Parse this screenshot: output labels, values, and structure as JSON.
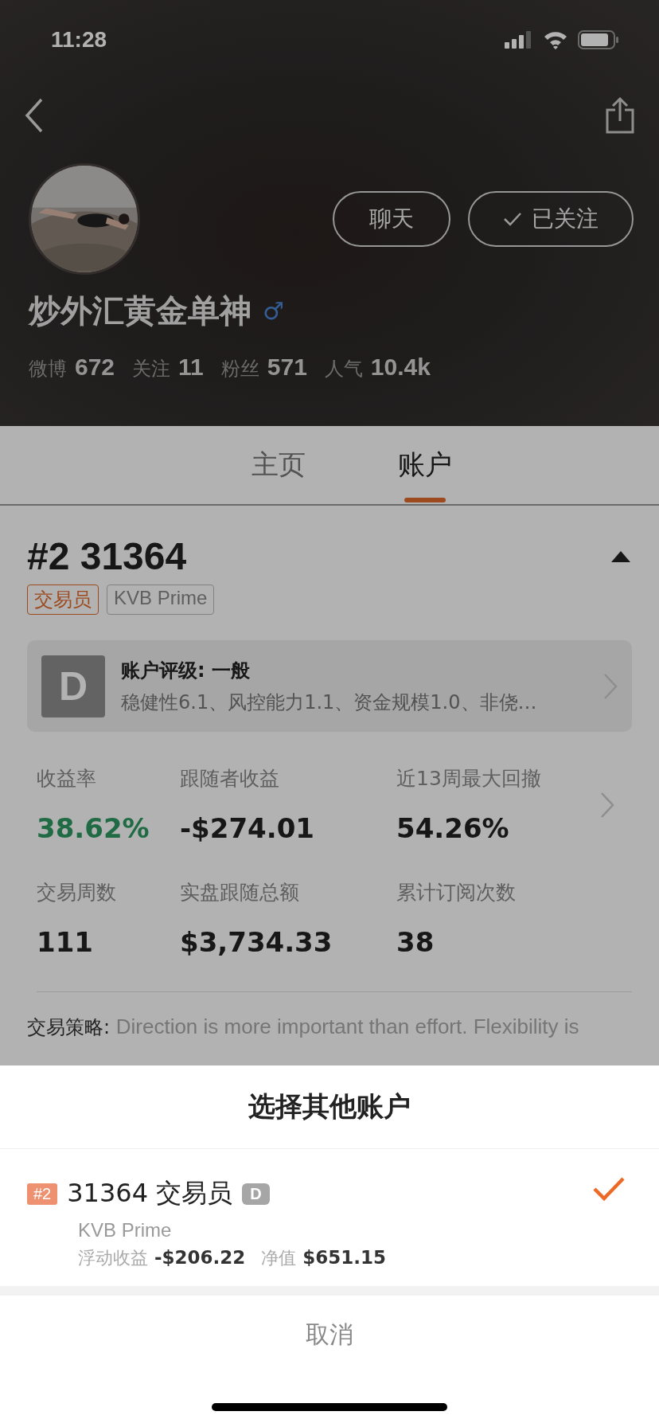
{
  "status_bar": {
    "time": "11:28"
  },
  "profile": {
    "name": "炒外汇黄金单神",
    "gender_symbol": "♂",
    "buttons": [
      {
        "label": "聊天",
        "kind": "plain"
      },
      {
        "label": "已关注",
        "kind": "followed",
        "checked": true
      }
    ],
    "stats": [
      {
        "label": "微博",
        "value": "672"
      },
      {
        "label": "关注",
        "value": "11"
      },
      {
        "label": "粉丝",
        "value": "571"
      },
      {
        "label": "人气",
        "value": "10.4k"
      }
    ]
  },
  "tabs": [
    {
      "label": "主页",
      "selected": false
    },
    {
      "label": "账户",
      "selected": true
    }
  ],
  "account": {
    "title": "#2 31364",
    "expanded": true,
    "tags": [
      {
        "label": "交易员",
        "kind": "role"
      },
      {
        "label": "KVB Prime",
        "kind": "broker"
      }
    ],
    "rating": {
      "grade": "D",
      "title": "账户评级: 一般",
      "description": "稳健性6.1、风控能力1.1、资金规模1.0、非侥…"
    },
    "metrics": [
      {
        "label": "收益率",
        "value": "38.62%",
        "positive": true
      },
      {
        "label": "跟随者收益",
        "value": "-$274.01",
        "positive": false
      },
      {
        "label": "近13周最大回撤",
        "value": "54.26%",
        "positive": false
      },
      {
        "label": "交易周数",
        "value": "111",
        "positive": false
      },
      {
        "label": "实盘跟随总额",
        "value": "$3,734.33",
        "positive": false
      },
      {
        "label": "累计订阅次数",
        "value": "38",
        "positive": false
      }
    ],
    "strategy": {
      "label": "交易策略:",
      "text": "Direction is more important than effort. Flexibility is"
    }
  },
  "sheet": {
    "title": "选择其他账户",
    "accounts": [
      {
        "index": "#2",
        "number": "31364",
        "role": "交易员",
        "grade": "D",
        "broker": "KVB Prime",
        "floating_label": "浮动收益",
        "floating_value": "-$206.22",
        "equity_label": "净值",
        "equity_value": "$651.15",
        "selected": true
      }
    ],
    "cancel": "取消"
  }
}
